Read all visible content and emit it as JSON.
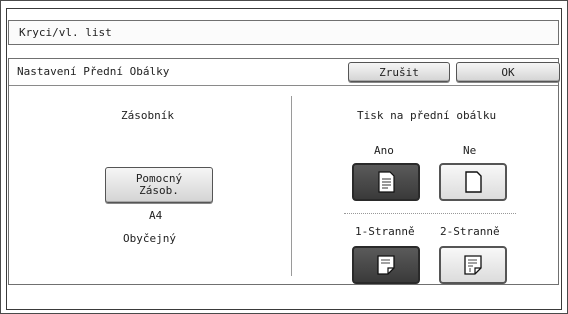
{
  "window": {
    "title": "Kryci/vl. list"
  },
  "panel": {
    "title": "Nastavení Přední Obálky",
    "cancel_label": "Zrušit",
    "ok_label": "OK"
  },
  "tray": {
    "heading": "Zásobník",
    "button_line1": "Pomocný",
    "button_line2": "Zásob.",
    "paper_size": "A4",
    "paper_type": "Obyčejný"
  },
  "print": {
    "heading": "Tisk na přední obálku",
    "yes_label": "Ano",
    "no_label": "Ne",
    "one_sided_label": "1-Stranně",
    "two_sided_label": "2-Stranně",
    "selected_print": "yes",
    "selected_sides": "one-sided"
  },
  "icons": {
    "yes": "printed-page-icon",
    "no": "blank-page-icon",
    "one_sided": "one-sided-page-icon",
    "two_sided": "two-sided-page-icon"
  },
  "colors": {
    "selected_button": "#3a3a3a",
    "button_face": "#e8e8e8",
    "border": "#555555"
  }
}
